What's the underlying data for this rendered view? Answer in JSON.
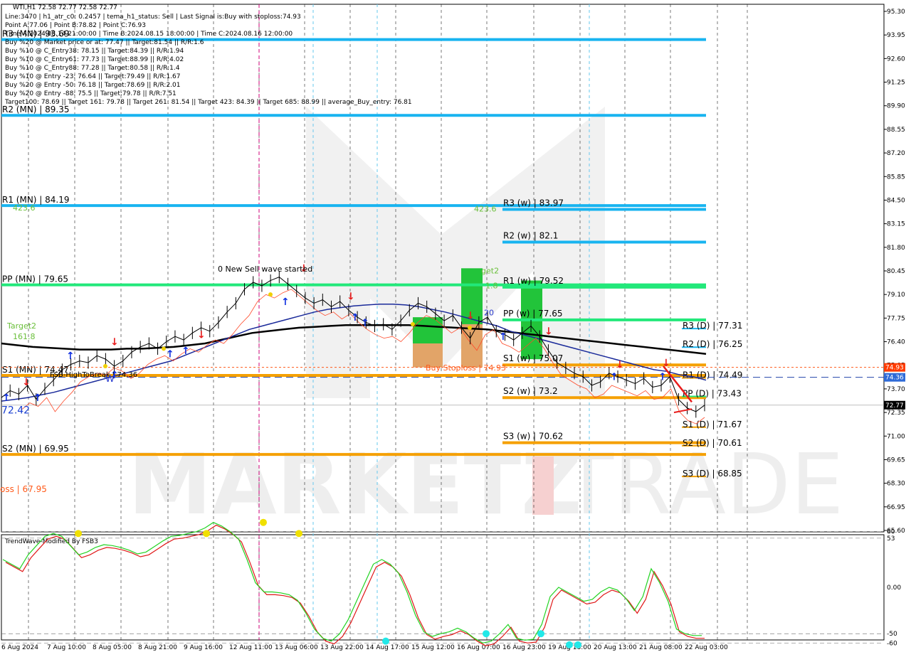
{
  "chart_data": {
    "type": "line",
    "symbol_line": "WTI,H1  72.58 72.77 72.58 72.77",
    "info_lines": [
      "Line:3470 | h1_atr_c0: 0.2457 | tema_h1_status: Sell | Last Signal is:Buy with stoploss:74.93",
      "Point A:77.06 | Point B:78.82 | Point C:76.93",
      "Time A:2024.08.14 21:00:00 | Time B:2024.08.15 18:00:00 | Time C:2024.08.16 12:00:00",
      "Buy %20 @ Market price or at: 77.47 || Target:81.54 || R/R:1.6",
      "Buy %10 @ C_Entry38: 78.15 || Target:84.39 || R/R:1.94",
      "Buy %10 @ C_Entry61: 77.73 || Target:88.99 || R/R:4.02",
      "Buy %10 @ C_Entry88: 77.28 || Target:80.58 || R/R:1.4",
      "Buy %10 @ Entry -23: 76.64 || Target:79.49 || R/R:1.67",
      "Buy %20 @ Entry -50: 76.18 || Target:78.69 || R/R:2.01",
      "Buy %20 @ Entry -88: 75.5 || Target:79.78 || R/R:7.51",
      "Target100: 78.69 || Target 161: 79.78 || Target 261: 81.54 || Target 423: 84.39 || Target 685: 88.99 || average_Buy_entry: 76.81"
    ],
    "y_ticks": [
      "95.30",
      "93.95",
      "92.60",
      "91.25",
      "89.90",
      "88.55",
      "87.20",
      "85.85",
      "84.50",
      "83.15",
      "81.80",
      "80.45",
      "79.10",
      "77.75",
      "76.40",
      "75.05",
      "73.70",
      "72.35",
      "71.00",
      "69.65",
      "68.30",
      "66.95",
      "65.60"
    ],
    "ylim": [
      65.6,
      95.3
    ],
    "x_ticks": [
      "6 Aug 2024",
      "7 Aug 10:00",
      "8 Aug 05:00",
      "8 Aug 21:00",
      "9 Aug 16:00",
      "12 Aug 11:00",
      "13 Aug 06:00",
      "13 Aug 22:00",
      "14 Aug 17:00",
      "15 Aug 12:00",
      "16 Aug 07:00",
      "16 Aug 23:00",
      "19 Aug 18:00",
      "20 Aug 13:00",
      "21 Aug 08:00",
      "22 Aug 03:00"
    ],
    "price_tags": [
      {
        "text": "74.93",
        "price": 74.93,
        "color": "#ff3b00"
      },
      {
        "text": "74.36",
        "price": 74.36,
        "color": "#2f6bd8"
      },
      {
        "text": "72.77",
        "price": 72.77,
        "color": "#000000"
      }
    ],
    "monthly_levels": [
      {
        "label": "R3 (MN) | 93.69",
        "price": 93.69,
        "color": "#18b4f0"
      },
      {
        "label": "R2 (MN) | 89.35",
        "price": 89.35,
        "color": "#18b4f0"
      },
      {
        "label": "R1 (MN) | 84.19",
        "price": 84.19,
        "color": "#18b4f0"
      },
      {
        "label": "PP (MN) | 79.65",
        "price": 79.65,
        "color": "#22e87a"
      },
      {
        "label": "S1 (MN) | 74.47",
        "price": 74.47,
        "color": "#f5a000"
      },
      {
        "label": "S2 (MN) | 69.95",
        "price": 69.95,
        "color": "#f5a000"
      }
    ],
    "weekly_levels": [
      {
        "label": "R3 (w) | 83.97",
        "price": 83.97,
        "color": "#18b4f0"
      },
      {
        "label": "R2 (w) | 82.1",
        "price": 82.1,
        "color": "#18b4f0"
      },
      {
        "label": "R1 (w) | 79.52",
        "price": 79.52,
        "color": "#22e87a"
      },
      {
        "label": "PP (w) | 77.65",
        "price": 77.65,
        "color": "#22e87a"
      },
      {
        "label": "S1 (w) | 75.07",
        "price": 75.07,
        "color": "#f5a000"
      },
      {
        "label": "S2 (w) | 73.2",
        "price": 73.2,
        "color": "#f5a000"
      },
      {
        "label": "S3 (w) | 70.62",
        "price": 70.62,
        "color": "#f5a000"
      }
    ],
    "daily_levels": [
      {
        "label": "R3 (D) | 77.31",
        "price": 77.31,
        "color": "#18b4f0"
      },
      {
        "label": "R2 (D) | 76.25",
        "price": 76.25,
        "color": "#18b4f0"
      },
      {
        "label": "R1 (D) | 74.49",
        "price": 74.49,
        "color": "#f5a000"
      },
      {
        "label": "PP (D) | 73.43",
        "price": 73.43,
        "color": "#22e87a"
      },
      {
        "label": "S1 (D) | 71.67",
        "price": 71.67,
        "color": "#f5a000"
      },
      {
        "label": "S2 (D) | 70.61",
        "price": 70.61,
        "color": "#f5a000"
      },
      {
        "label": "S3 (D) | 68.85",
        "price": 68.85,
        "color": "#f5a000"
      }
    ],
    "annotations": {
      "sell_wave": "0 New Sell wave started",
      "buy_stoploss": "Buy Stoploss | 74.93",
      "fsb_break": "FSB-HighToBreak | 74.36",
      "target2_left": "Target2",
      "target2_left_value": "161.8",
      "target2_right": "get2",
      "target2_right_value": "1.8",
      "t423_left": "423.6",
      "t423_right": "423.6",
      "left_price": "72.42",
      "left_stoploss": "oss | 67.95",
      "w_label": "W",
      "z_label": "20"
    },
    "price_series": [
      {
        "name": "close",
        "values": [
          73.2,
          73.6,
          73.4,
          73.9,
          73.1,
          73.7,
          74.2,
          74.8,
          75.1,
          75.3,
          75.2,
          75.6,
          75.4,
          75.0,
          75.3,
          75.8,
          76.1,
          76.3,
          76.0,
          76.4,
          76.7,
          76.5,
          76.9,
          77.2,
          77.0,
          77.5,
          78.1,
          78.6,
          79.4,
          79.8,
          79.6,
          79.9,
          80.1,
          79.7,
          79.3,
          78.9,
          78.6,
          78.8,
          78.4,
          78.7,
          78.2,
          77.8,
          77.5,
          77.3,
          77.4,
          77.1,
          77.6,
          78.2,
          78.6,
          78.4,
          78.0,
          77.6,
          77.9,
          77.2,
          76.6,
          77.5,
          77.8,
          77.0,
          76.8,
          76.5,
          76.9,
          77.3,
          76.7,
          75.9,
          75.2,
          74.9,
          74.6,
          74.4,
          73.9,
          74.1,
          74.6,
          74.4,
          74.2,
          74.0,
          74.3,
          73.8,
          73.9,
          74.4,
          73.1,
          72.6,
          72.4,
          72.77
        ]
      },
      {
        "name": "blue-ma",
        "values": [
          73.0,
          73.1,
          73.2,
          73.35,
          73.5,
          73.7,
          73.9,
          74.1,
          74.3,
          74.5,
          74.7,
          74.9,
          75.1,
          75.3,
          75.6,
          75.9,
          76.2,
          76.5,
          76.8,
          77.1,
          77.3,
          77.5,
          77.7,
          77.9,
          78.1,
          78.25,
          78.35,
          78.45,
          78.5,
          78.55,
          78.55,
          78.5,
          78.4,
          78.25,
          78.1,
          77.9,
          77.7,
          77.5,
          77.3,
          77.0,
          76.8,
          76.6,
          76.4,
          76.2,
          76.0,
          75.8,
          75.6,
          75.4,
          75.2,
          75.0,
          74.8,
          74.7,
          74.5,
          74.4,
          74.2
        ]
      },
      {
        "name": "black-ma",
        "values": [
          76.3,
          76.2,
          76.1,
          76.05,
          76.0,
          75.95,
          75.95,
          75.95,
          76.0,
          76.0,
          76.05,
          76.1,
          76.2,
          76.3,
          76.5,
          76.7,
          76.9,
          77.0,
          77.1,
          77.2,
          77.25,
          77.3,
          77.35,
          77.35,
          77.35,
          77.35,
          77.35,
          77.3,
          77.25,
          77.2,
          77.15,
          77.1,
          77.0,
          76.9,
          76.8,
          76.7,
          76.6,
          76.5,
          76.4,
          76.3,
          76.2,
          76.1,
          76.0,
          75.9,
          75.8,
          75.7
        ]
      }
    ],
    "oscillator": {
      "title": "TrendWave-Modified By FSB3",
      "y_ticks": [
        "60",
        "53",
        "0.00",
        "-50",
        "-60"
      ],
      "ylim": [
        -73,
        73
      ],
      "green": [
        30,
        25,
        20,
        35,
        45,
        55,
        58,
        55,
        45,
        35,
        38,
        43,
        46,
        45,
        43,
        40,
        36,
        38,
        44,
        50,
        55,
        56,
        58,
        60,
        64,
        70,
        66,
        60,
        52,
        30,
        5,
        -5,
        -5,
        -6,
        -8,
        -14,
        -28,
        -45,
        -55,
        -58,
        -50,
        -35,
        -15,
        5,
        25,
        30,
        25,
        15,
        -5,
        -30,
        -48,
        -53,
        -50,
        -48,
        -44,
        -48,
        -55,
        -60,
        -58,
        -50,
        -40,
        -55,
        -57,
        -56,
        -40,
        -10,
        0,
        -5,
        -10,
        -15,
        -13,
        -5,
        0,
        -3,
        -12,
        -25,
        -10,
        20,
        5,
        -15,
        -45,
        -50,
        -52,
        -52
      ]
    }
  }
}
